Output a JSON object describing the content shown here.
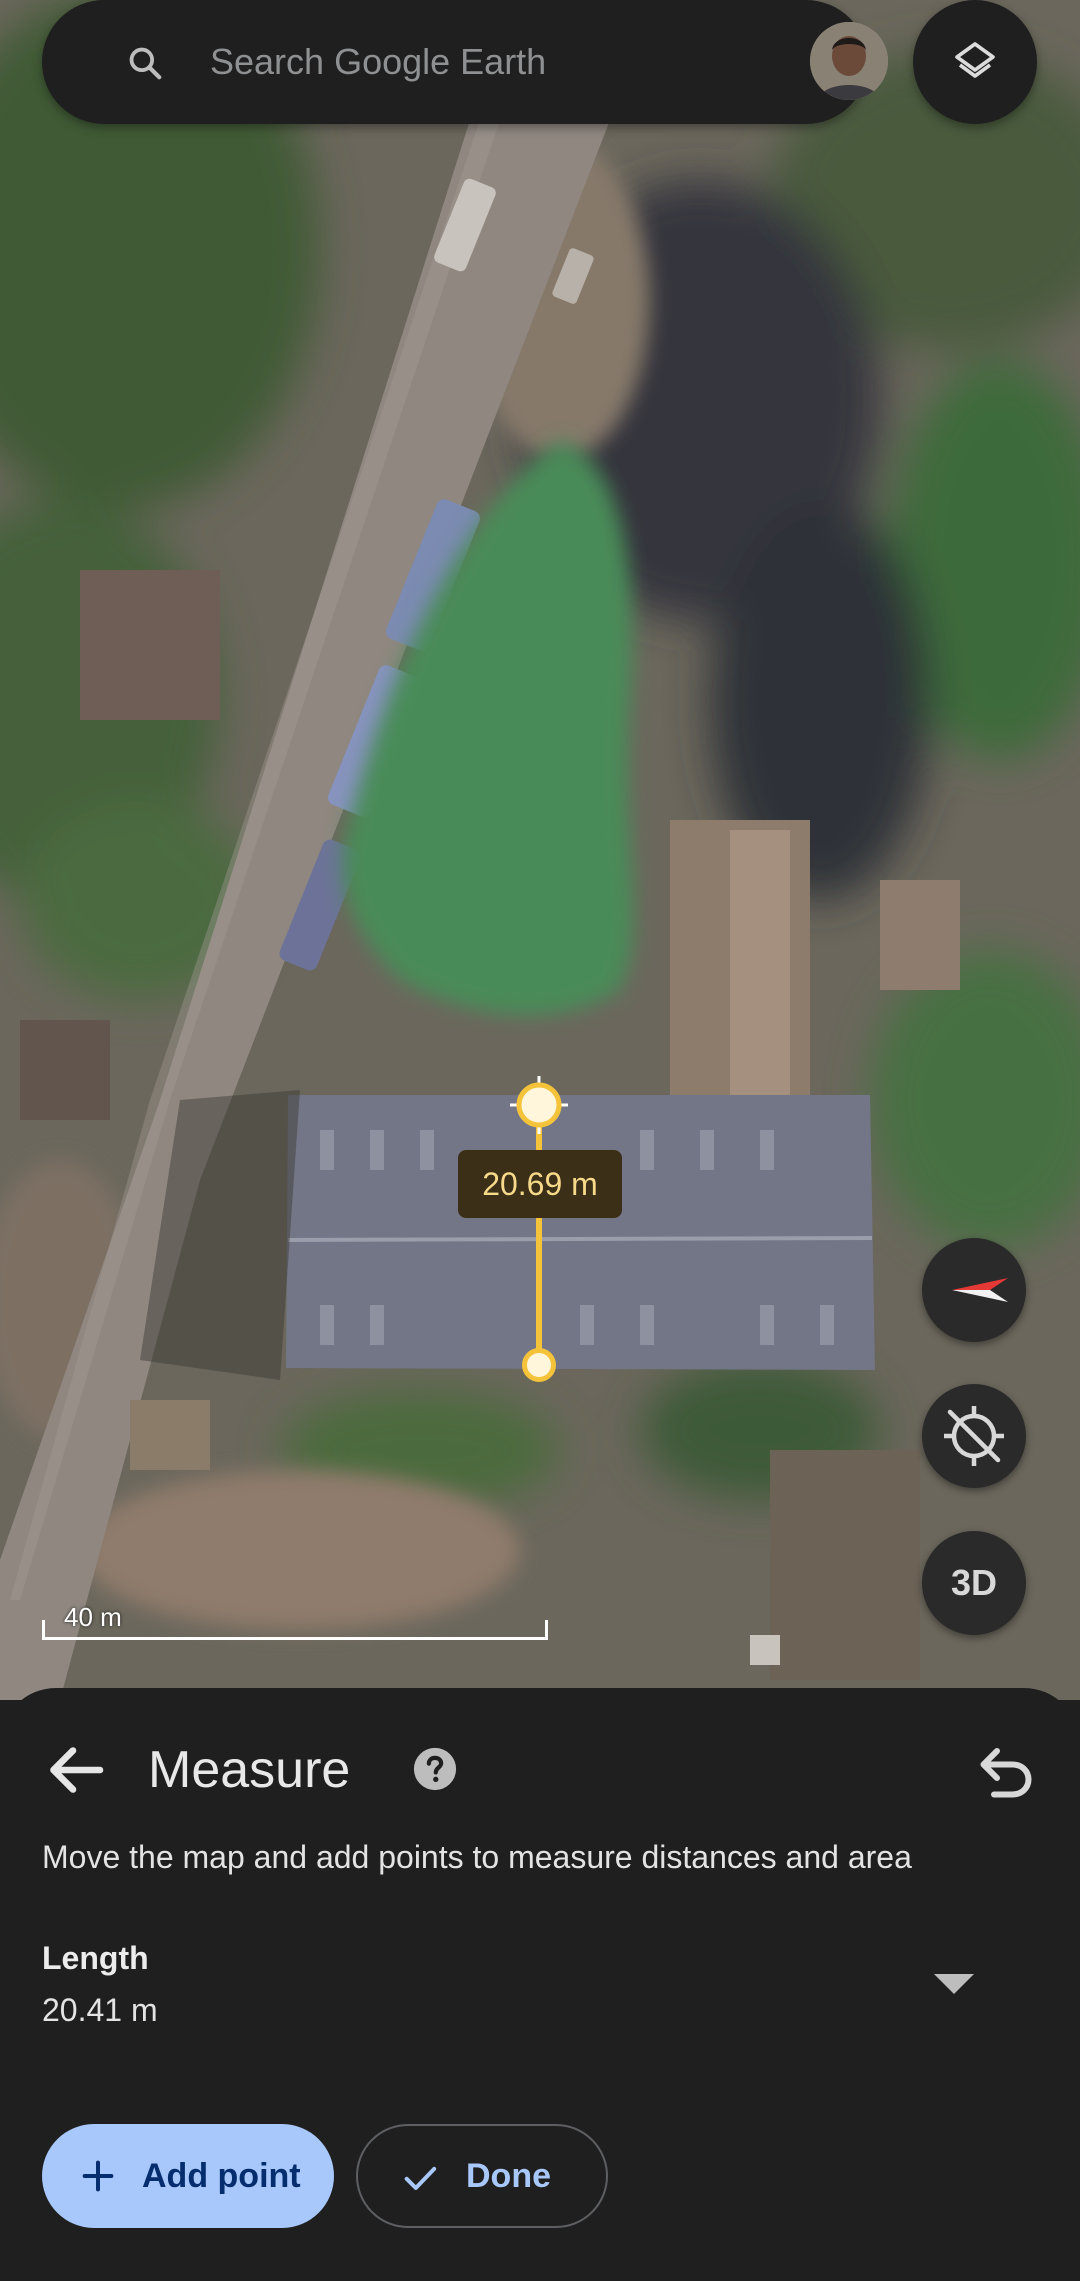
{
  "search": {
    "placeholder": "Search Google Earth"
  },
  "icons": {
    "search": "search-icon",
    "layers": "layers-icon",
    "compass": "compass-icon",
    "location": "location-off-icon",
    "back": "arrow-back-icon",
    "help": "help-icon",
    "undo": "undo-icon",
    "dropdown": "dropdown-arrow-icon",
    "add": "plus-icon",
    "done": "check-icon"
  },
  "map": {
    "measurement_label": "20.69 m",
    "view_mode_button": "3D",
    "scale_label": "40 m"
  },
  "sheet": {
    "title": "Measure",
    "instruction": "Move the map and add points to measure distances and area",
    "length_label": "Length",
    "length_value": "20.41 m",
    "add_point_label": "Add point",
    "done_label": "Done"
  },
  "colors": {
    "measure_line": "#f5c33a",
    "primary_button": "#a8c7fa",
    "sheet_background": "#1f1f1f"
  }
}
